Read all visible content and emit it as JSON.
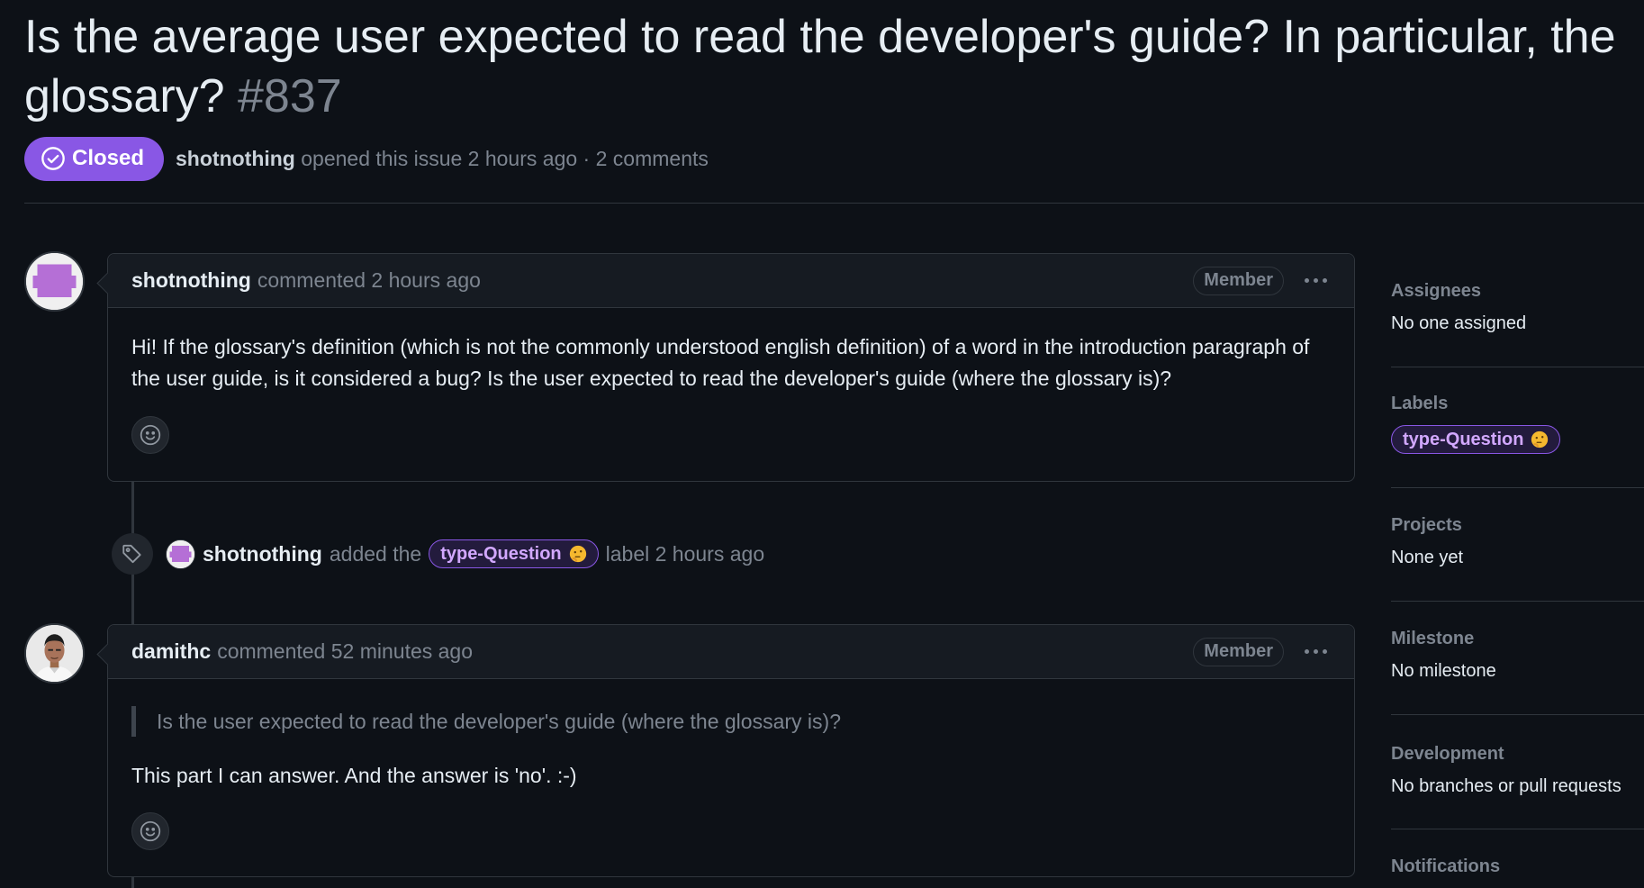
{
  "issue": {
    "title": "Is the average user expected to read the developer's guide? In particular, the glossary?",
    "number": "#837",
    "state": "Closed",
    "state_color": "#8957e5",
    "author": "shotnothing",
    "opened_text": "opened this issue 2 hours ago",
    "separator": "·",
    "comments_count": "2 comments"
  },
  "comments": [
    {
      "author": "shotnothing",
      "action": "commented 2 hours ago",
      "role": "Member",
      "body": "Hi! If the glossary's definition (which is not the commonly understood english definition) of a word in the introduction paragraph of the user guide, is it considered a bug? Is the user expected to read the developer's guide (where the glossary is)?",
      "avatar_icon": "identicon-icon"
    },
    {
      "author": "damithc",
      "action": "commented 52 minutes ago",
      "role": "Member",
      "quote": "Is the user expected to read the developer's guide (where the glossary is)?",
      "body": "This part I can answer. And the answer is 'no'. :-)",
      "avatar_icon": "user-photo-icon"
    }
  ],
  "event": {
    "icon": "tag-icon",
    "author": "shotnothing",
    "pre_text": "added the",
    "label": "type-Question",
    "post_text": "label 2 hours ago"
  },
  "sidebar": {
    "assignees": {
      "heading": "Assignees",
      "value": "No one assigned"
    },
    "labels": {
      "heading": "Labels",
      "label": "type-Question",
      "label_color": "#8957e5"
    },
    "projects": {
      "heading": "Projects",
      "value": "None yet"
    },
    "milestone": {
      "heading": "Milestone",
      "value": "No milestone"
    },
    "development": {
      "heading": "Development",
      "value": "No branches or pull requests"
    },
    "notifications": {
      "heading": "Notifications"
    }
  }
}
